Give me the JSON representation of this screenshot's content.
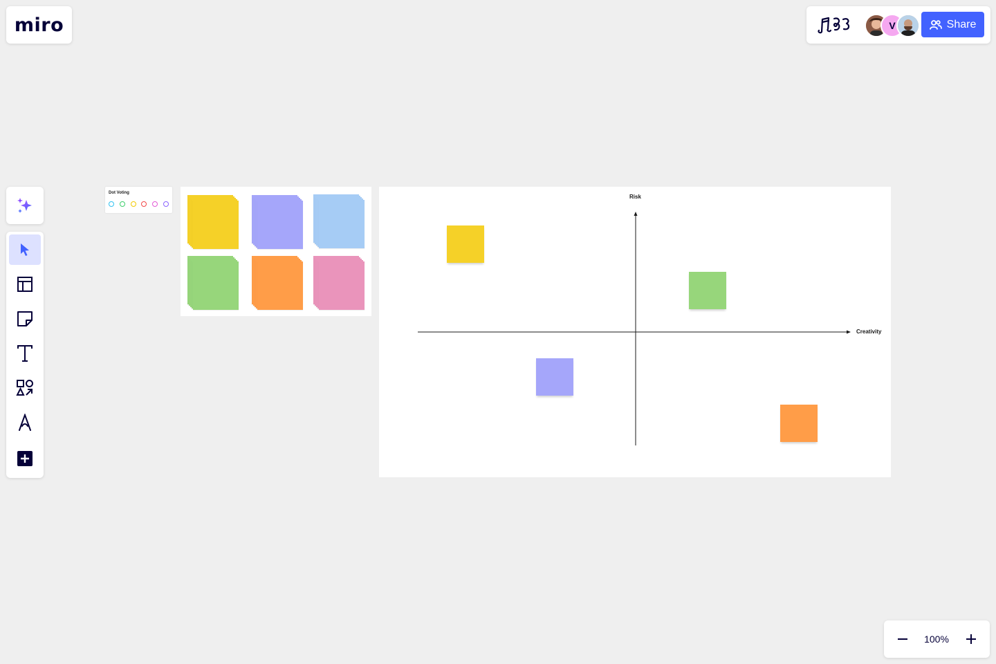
{
  "app": {
    "logo": "miro"
  },
  "header": {
    "share_label": "Share",
    "collaborators": [
      {
        "name": "collaborator-1",
        "initial": ""
      },
      {
        "name": "collaborator-2",
        "initial": "V"
      },
      {
        "name": "collaborator-3",
        "initial": ""
      }
    ]
  },
  "toolbar": {
    "tools": [
      "select",
      "templates",
      "sticky-note",
      "text",
      "shapes",
      "pen",
      "more"
    ],
    "active": "select"
  },
  "zoom": {
    "level": "100%"
  },
  "dot_voting": {
    "title": "Dot Voting",
    "dot_colors": [
      "#31c1f0",
      "#3ccf6b",
      "#f2c900",
      "#f24747",
      "#e35ad6",
      "#8a63ff"
    ]
  },
  "sticky_pads": {
    "colors": [
      "#f5d128",
      "#a5a6fa",
      "#a6ccf5",
      "#97d67b",
      "#ff9d48",
      "#ea94bb"
    ]
  },
  "matrix": {
    "y_axis_label": "Risk",
    "x_axis_label": "Creativity",
    "notes": [
      {
        "color": "#f5d128",
        "creativity": -0.78,
        "risk": 0.74
      },
      {
        "color": "#97d67b",
        "creativity": 0.33,
        "risk": 0.35
      },
      {
        "color": "#a5a6fa",
        "creativity": -0.37,
        "risk": -0.38
      },
      {
        "color": "#ff9d48",
        "creativity": 0.75,
        "risk": -0.77
      }
    ]
  }
}
